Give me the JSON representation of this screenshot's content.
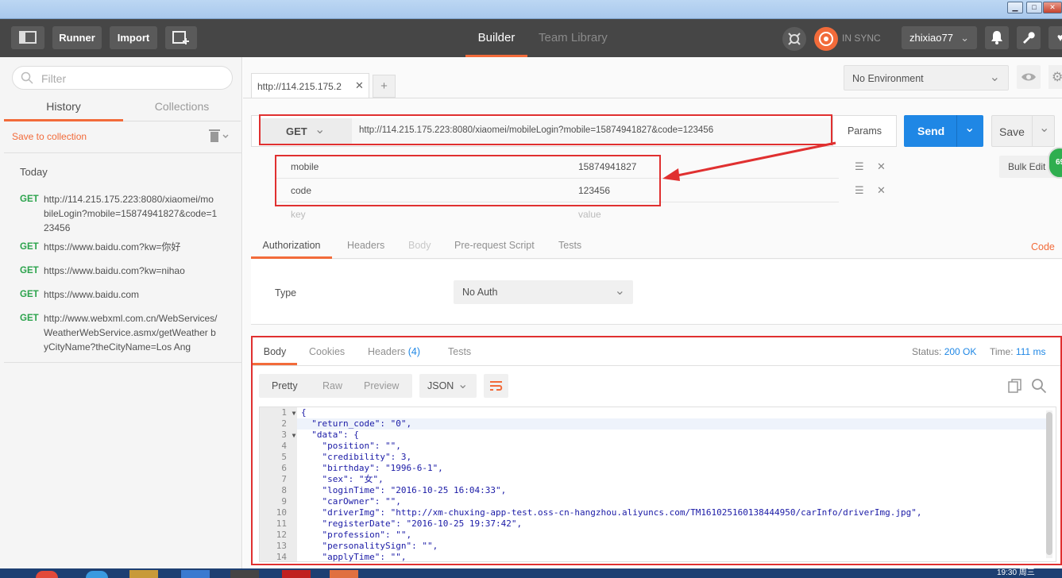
{
  "window": {
    "min": "▁",
    "max": "□",
    "close": "✕"
  },
  "topbar": {
    "runner": "Runner",
    "import": "Import",
    "builder": "Builder",
    "team_library": "Team Library",
    "sync": "IN SYNC",
    "user": "zhixiao77"
  },
  "sidebar": {
    "filter_placeholder": "Filter",
    "tabs": [
      "History",
      "Collections"
    ],
    "save_to_collection": "Save to collection",
    "today": "Today",
    "items": [
      {
        "method": "GET",
        "url": "http://114.215.175.223:8080/xiaomei/mobileLogin?mobile=15874941827&code=123456"
      },
      {
        "method": "GET",
        "url": "https://www.baidu.com?kw=你好"
      },
      {
        "method": "GET",
        "url": "https://www.baidu.com?kw=nihao"
      },
      {
        "method": "GET",
        "url": "https://www.baidu.com"
      },
      {
        "method": "GET",
        "url": "http://www.webxml.com.cn/WebServices/WeatherWebService.asmx/getWeather byCityName?theCityName=Los Ang"
      }
    ]
  },
  "request": {
    "tab_label": "http://114.215.175.2",
    "add_tab": "+",
    "environment": "No Environment",
    "method": "GET",
    "url": "http://114.215.175.223:8080/xiaomei/mobileLogin?mobile=15874941827&code=123456",
    "params": "Params",
    "send": "Send",
    "save": "Save",
    "bulk_edit": "Bulk Edit",
    "badge": "69",
    "rows": [
      {
        "key": "mobile",
        "value": "15874941827"
      },
      {
        "key": "code",
        "value": "123456"
      }
    ],
    "key_placeholder": "key",
    "value_placeholder": "value",
    "subtabs": [
      "Authorization",
      "Headers",
      "Body",
      "Pre-request Script",
      "Tests"
    ],
    "code_link": "Code",
    "type_label": "Type",
    "auth_value": "No Auth"
  },
  "response": {
    "tabs": [
      "Body",
      "Cookies",
      "Headers",
      "Tests"
    ],
    "headers_count": "(4)",
    "status_label": "Status:",
    "status_value": "200 OK",
    "time_label": "Time:",
    "time_value": "111 ms",
    "views": [
      "Pretty",
      "Raw",
      "Preview"
    ],
    "format": "JSON",
    "lines": [
      {
        "n": "1",
        "t": "{"
      },
      {
        "n": "2",
        "t": "  \"return_code\": \"0\","
      },
      {
        "n": "3",
        "t": "  \"data\": {"
      },
      {
        "n": "4",
        "t": "    \"position\": \"\","
      },
      {
        "n": "5",
        "t": "    \"credibility\": 3,"
      },
      {
        "n": "6",
        "t": "    \"birthday\": \"1996-6-1\","
      },
      {
        "n": "7",
        "t": "    \"sex\": \"女\","
      },
      {
        "n": "8",
        "t": "    \"loginTime\": \"2016-10-25 16:04:33\","
      },
      {
        "n": "9",
        "t": "    \"carOwner\": \"\","
      },
      {
        "n": "10",
        "t": "    \"driverImg\": \"http://xm-chuxing-app-test.oss-cn-hangzhou.aliyuncs.com/TM161025160138444950/carInfo/driverImg.jpg\","
      },
      {
        "n": "11",
        "t": "    \"registerDate\": \"2016-10-25 19:37:42\","
      },
      {
        "n": "12",
        "t": "    \"profession\": \"\","
      },
      {
        "n": "13",
        "t": "    \"personalitySign\": \"\","
      },
      {
        "n": "14",
        "t": "    \"applyTime\": \"\","
      }
    ]
  },
  "taskbar": {
    "clock": "19:30 周三"
  }
}
